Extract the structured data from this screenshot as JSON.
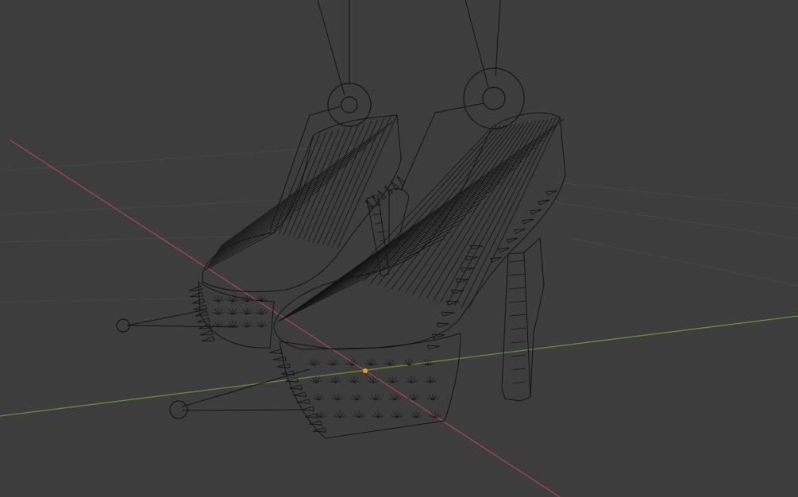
{
  "viewport": {
    "mode": "wireframe",
    "background_color": "#3d3d3d",
    "wire_color": "#141414",
    "grid_color": "#494949",
    "x_axis_color": "#9b4a57",
    "y_axis_color": "#6d8b3c",
    "origin_color": "#f29b22"
  },
  "objects": [
    {
      "name": "shoe-left",
      "type": "mesh"
    },
    {
      "name": "shoe-right",
      "type": "mesh"
    },
    {
      "name": "armature-handles",
      "type": "armature"
    }
  ]
}
